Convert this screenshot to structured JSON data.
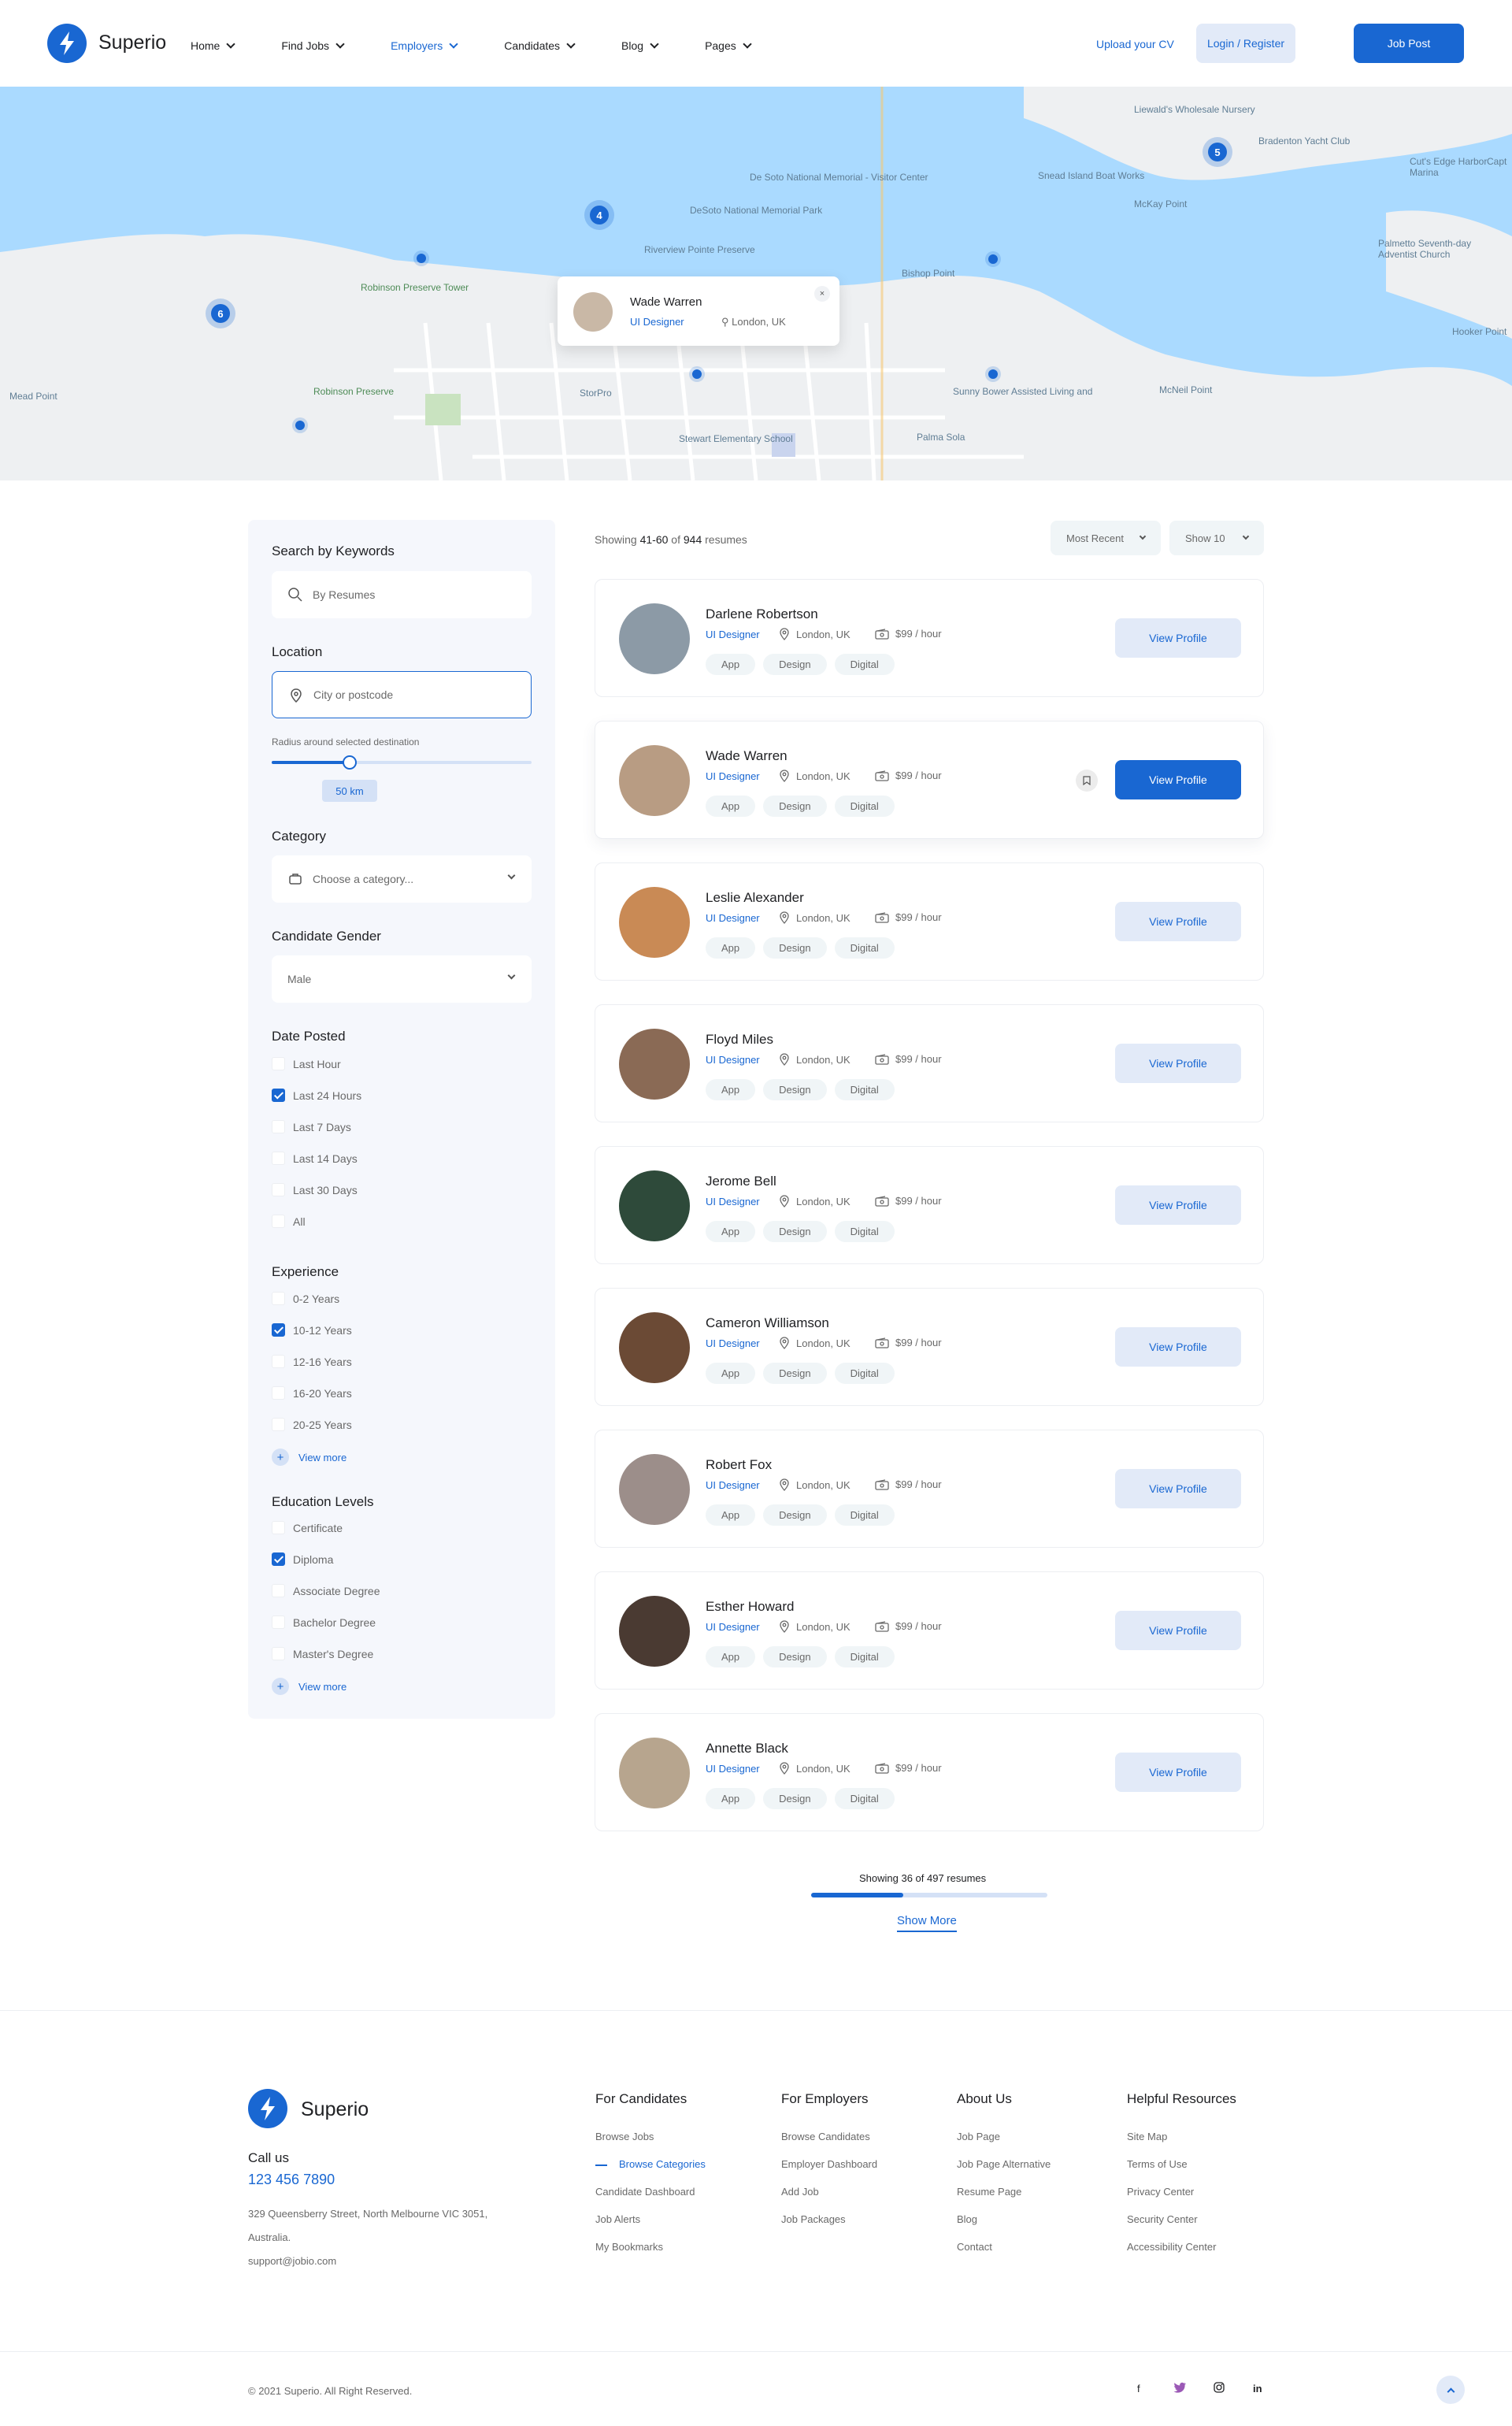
{
  "brand": {
    "name": "Superio",
    "color": "#1967d2"
  },
  "nav": [
    {
      "label": "Home",
      "active": false
    },
    {
      "label": "Find Jobs",
      "active": false
    },
    {
      "label": "Employers",
      "active": true
    },
    {
      "label": "Candidates",
      "active": false
    },
    {
      "label": "Blog",
      "active": false
    },
    {
      "label": "Pages",
      "active": false
    }
  ],
  "header": {
    "upload_cv": "Upload your CV",
    "login_register": "Login / Register",
    "job_post": "Job Post"
  },
  "map": {
    "clusters": [
      "4",
      "5",
      "6"
    ],
    "labels": [
      "Liewald's Wholesale Nursery",
      "Bradenton Yacht Club",
      "Snead Island Boat Works",
      "McKay Point",
      "Cut's Edge Harbor Marina",
      "De Soto National Memorial - Visitor Center",
      "DeSoto National Memorial Park",
      "Riverview Pointe Preserve",
      "Robinson Preserve Tower",
      "Bishop Point",
      "Robinson Preserve",
      "StorPro",
      "Mead Point",
      "Sunny Bower Assisted Living and",
      "Stewart Elementary School",
      "Palma Sola",
      "McNeil Point",
      "Palmetto Seventh-day Adventist Church",
      "Hooker Point",
      "Capt"
    ],
    "popup": {
      "name": "Wade Warren",
      "role": "UI Designer",
      "location": "London, UK",
      "close": "×"
    }
  },
  "filters": {
    "keywords": {
      "title": "Search by Keywords",
      "placeholder": "By Resumes"
    },
    "location": {
      "title": "Location",
      "placeholder": "City or postcode",
      "radius_label": "Radius around selected destination",
      "radius_value": "50 km",
      "radius_fraction": 0.3
    },
    "category": {
      "title": "Category",
      "value": "Choose a category..."
    },
    "gender": {
      "title": "Candidate Gender",
      "value": "Male"
    },
    "date_posted": {
      "title": "Date Posted",
      "options": [
        {
          "label": "Last Hour",
          "checked": false
        },
        {
          "label": "Last 24 Hours",
          "checked": true
        },
        {
          "label": "Last 7 Days",
          "checked": false
        },
        {
          "label": "Last 14 Days",
          "checked": false
        },
        {
          "label": "Last 30 Days",
          "checked": false
        },
        {
          "label": "All",
          "checked": false
        }
      ]
    },
    "experience": {
      "title": "Experience",
      "view_more": "View more",
      "options": [
        {
          "label": "0-2 Years",
          "checked": false
        },
        {
          "label": "10-12 Years",
          "checked": true
        },
        {
          "label": "12-16 Years",
          "checked": false
        },
        {
          "label": "16-20 Years",
          "checked": false
        },
        {
          "label": "20-25 Years",
          "checked": false
        }
      ]
    },
    "education": {
      "title": "Education Levels",
      "view_more": "View more",
      "options": [
        {
          "label": "Certificate",
          "checked": false
        },
        {
          "label": "Diploma",
          "checked": true
        },
        {
          "label": "Associate Degree",
          "checked": false
        },
        {
          "label": "Bachelor Degree",
          "checked": false
        },
        {
          "label": "Master's Degree",
          "checked": false
        }
      ]
    }
  },
  "results": {
    "showing_prefix": "Showing",
    "showing_range": "41-60",
    "showing_of": "of",
    "showing_total": "944",
    "showing_suffix": "resumes",
    "sort": "Most Recent",
    "per_page": "Show 10",
    "candidates": [
      {
        "name": "Darlene Robertson",
        "role": "UI Designer",
        "location": "London, UK",
        "rate": "$99 / hour",
        "tags": [
          "App",
          "Design",
          "Digital"
        ],
        "button": "View Profile",
        "highlighted": false,
        "avatar_color": "#8c9aa6"
      },
      {
        "name": "Wade Warren",
        "role": "UI Designer",
        "location": "London, UK",
        "rate": "$99 / hour",
        "tags": [
          "App",
          "Design",
          "Digital"
        ],
        "button": "View Profile",
        "highlighted": true,
        "avatar_color": "#b89c83"
      },
      {
        "name": "Leslie Alexander",
        "role": "UI Designer",
        "location": "London, UK",
        "rate": "$99 / hour",
        "tags": [
          "App",
          "Design",
          "Digital"
        ],
        "button": "View Profile",
        "highlighted": false,
        "avatar_color": "#c98a55"
      },
      {
        "name": "Floyd Miles",
        "role": "UI Designer",
        "location": "London, UK",
        "rate": "$99 / hour",
        "tags": [
          "App",
          "Design",
          "Digital"
        ],
        "button": "View Profile",
        "highlighted": false,
        "avatar_color": "#8a6a55"
      },
      {
        "name": "Jerome Bell",
        "role": "UI Designer",
        "location": "London, UK",
        "rate": "$99 / hour",
        "tags": [
          "App",
          "Design",
          "Digital"
        ],
        "button": "View Profile",
        "highlighted": false,
        "avatar_color": "#2e4a3a"
      },
      {
        "name": "Cameron Williamson",
        "role": "UI Designer",
        "location": "London, UK",
        "rate": "$99 / hour",
        "tags": [
          "App",
          "Design",
          "Digital"
        ],
        "button": "View Profile",
        "highlighted": false,
        "avatar_color": "#6b4a35"
      },
      {
        "name": "Robert Fox",
        "role": "UI Designer",
        "location": "London, UK",
        "rate": "$99 / hour",
        "tags": [
          "App",
          "Design",
          "Digital"
        ],
        "button": "View Profile",
        "highlighted": false,
        "avatar_color": "#9c8e8a"
      },
      {
        "name": "Esther Howard",
        "role": "UI Designer",
        "location": "London, UK",
        "rate": "$99 / hour",
        "tags": [
          "App",
          "Design",
          "Digital"
        ],
        "button": "View Profile",
        "highlighted": false,
        "avatar_color": "#4a3a32"
      },
      {
        "name": "Annette Black",
        "role": "UI Designer",
        "location": "London, UK",
        "rate": "$99 / hour",
        "tags": [
          "App",
          "Design",
          "Digital"
        ],
        "button": "View Profile",
        "highlighted": false,
        "avatar_color": "#b7a58e"
      }
    ],
    "pagination_text": "Showing 36 of 497 resumes",
    "progress_fraction": 0.39,
    "show_more": "Show More"
  },
  "footer": {
    "call_us": "Call us",
    "phone": "123 456 7890",
    "address_line1": "329 Queensberry Street, North Melbourne VIC 3051,",
    "address_line2": "Australia.",
    "email": "support@jobio.com",
    "columns": [
      {
        "title": "For Candidates",
        "links": [
          "Browse Jobs",
          "Browse Categories",
          "Candidate Dashboard",
          "Job Alerts",
          "My Bookmarks"
        ],
        "active_index": 1
      },
      {
        "title": "For Employers",
        "links": [
          "Browse Candidates",
          "Employer Dashboard",
          "Add Job",
          "Job Packages"
        ],
        "active_index": -1
      },
      {
        "title": "About Us",
        "links": [
          "Job Page",
          "Job Page Alternative",
          "Resume Page",
          "Blog",
          "Contact"
        ],
        "active_index": -1
      },
      {
        "title": "Helpful Resources",
        "links": [
          "Site Map",
          "Terms of Use",
          "Privacy Center",
          "Security Center",
          "Accessibility Center"
        ],
        "active_index": -1
      }
    ],
    "copyright": "© 2021 Superio. All Right Reserved.",
    "social": [
      "f",
      "twitter-icon",
      "instagram-icon",
      "in"
    ]
  }
}
